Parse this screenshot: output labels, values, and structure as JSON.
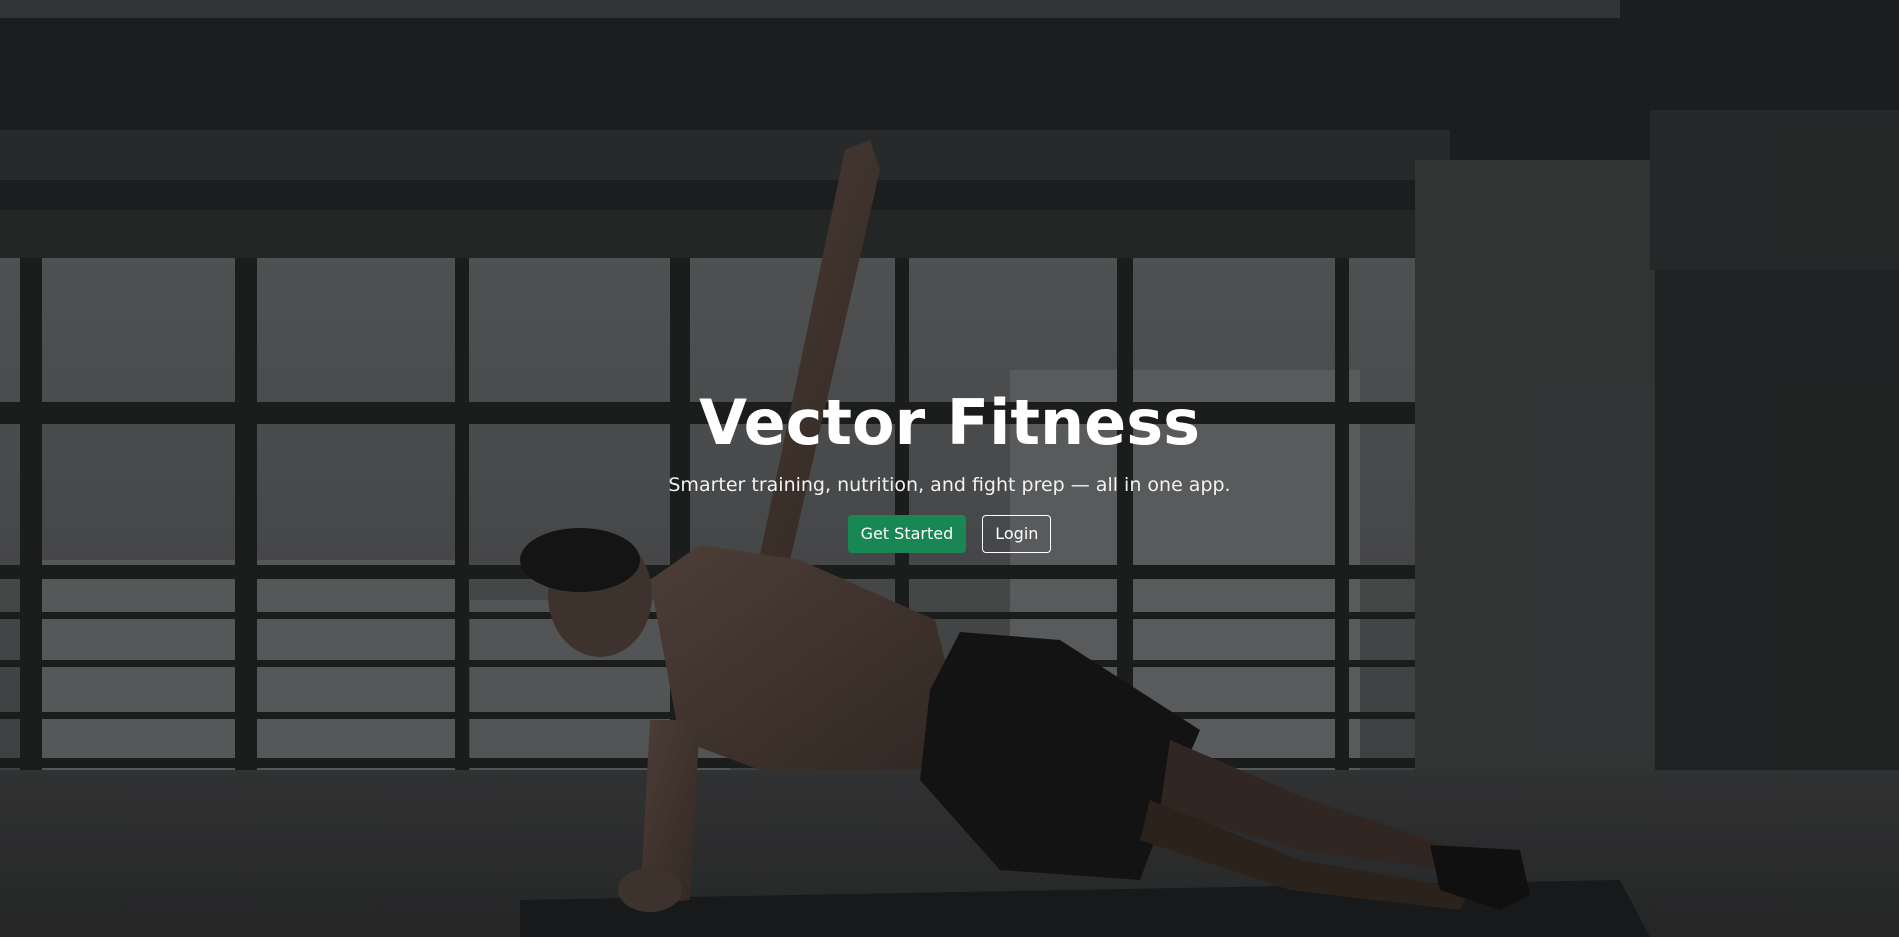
{
  "hero": {
    "title": "Vector Fitness",
    "subtitle": "Smarter training, nutrition, and fight prep — all in one app.",
    "background_image": "athlete-side-plank-photo",
    "actions": {
      "get_started_label": "Get Started",
      "login_label": "Login"
    }
  },
  "colors": {
    "primary_button": "#198754",
    "text": "#ffffff"
  }
}
